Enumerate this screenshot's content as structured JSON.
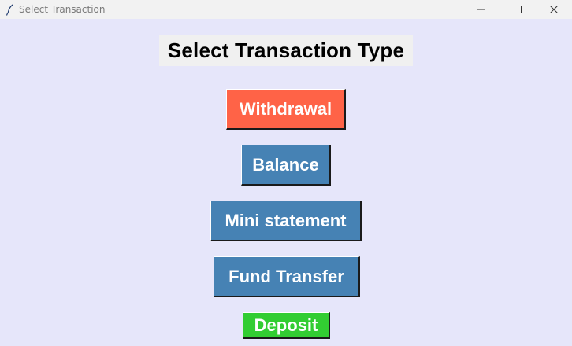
{
  "window": {
    "title": "Select Transaction",
    "icon": "feather-icon",
    "controls": [
      "minimize-icon",
      "maximize-icon",
      "close-icon"
    ]
  },
  "main": {
    "heading": "Select Transaction Type",
    "buttons": [
      {
        "label": "Withdrawal",
        "color": "#ff6347"
      },
      {
        "label": "Balance",
        "color": "#4682b4"
      },
      {
        "label": "Mini statement",
        "color": "#4682b4"
      },
      {
        "label": "Fund Transfer",
        "color": "#4682b4"
      },
      {
        "label": "Deposit",
        "color": "#32cd32"
      }
    ]
  },
  "colors": {
    "background": "#e6e6fa",
    "heading_background": "#f0f0f0",
    "titlebar": "#f2f2f2"
  }
}
